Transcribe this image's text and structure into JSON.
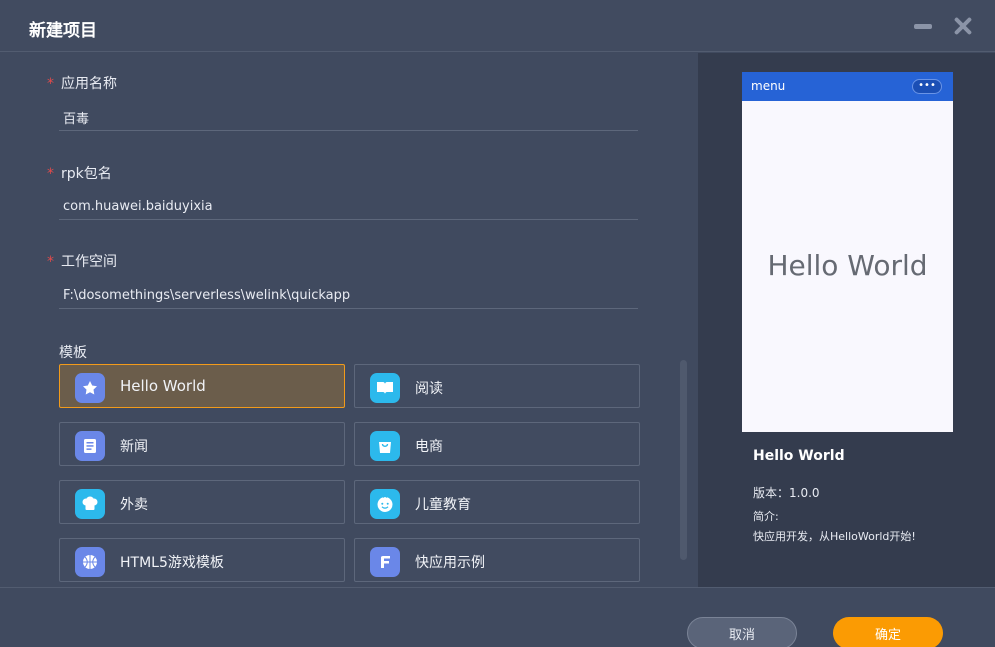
{
  "window": {
    "title": "新建项目"
  },
  "form": {
    "app_name": {
      "label": "应用名称",
      "required": "*",
      "value": "百毒"
    },
    "rpk_name": {
      "label": "rpk包名",
      "required": "*",
      "value": "com.huawei.baiduyixia"
    },
    "workspace": {
      "label": "工作空间",
      "required": "*",
      "value": "F:\\dosomethings\\serverless\\welink\\quickapp"
    }
  },
  "templates": {
    "label": "模板",
    "selected": "Hello World",
    "items": [
      {
        "name": "Hello World",
        "icon": "star-icon",
        "color": "#6a87e8"
      },
      {
        "name": "阅读",
        "icon": "book-icon",
        "color": "#2cb9ec"
      },
      {
        "name": "新闻",
        "icon": "news-icon",
        "color": "#6a87e8"
      },
      {
        "name": "电商",
        "icon": "shopping-bag-icon",
        "color": "#2cb9ec"
      },
      {
        "name": "外卖",
        "icon": "chef-hat-icon",
        "color": "#2cb9ec"
      },
      {
        "name": "儿童教育",
        "icon": "child-face-icon",
        "color": "#2cb9ec"
      },
      {
        "name": "HTML5游戏模板",
        "icon": "basketball-icon",
        "color": "#6a87e8"
      },
      {
        "name": "快应用示例",
        "icon": "f-letter-icon",
        "color": "#6a87e8"
      }
    ]
  },
  "preview": {
    "menu_label": "menu",
    "more_label": "•••",
    "hello_text": "Hello World",
    "name": "Hello World",
    "version": "版本：1.0.0",
    "intro_label": "简介:",
    "intro": "快应用开发，从HelloWorld开始!"
  },
  "footer": {
    "cancel_label": "取消",
    "ok_label": "确定"
  },
  "colors": {
    "accent": "#fb9b03",
    "selected_border": "#f29b1b",
    "phone_bar": "#2663d6"
  }
}
